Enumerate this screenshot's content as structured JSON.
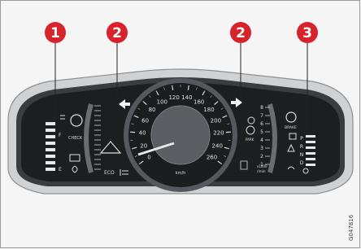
{
  "callouts": [
    {
      "number": "1",
      "color": "#d8232a"
    },
    {
      "number": "2",
      "color": "#d8232a"
    },
    {
      "number": "2",
      "color": "#d8232a"
    },
    {
      "number": "3",
      "color": "#d8232a"
    }
  ],
  "speedometer": {
    "ticks": [
      "0",
      "20",
      "40",
      "60",
      "80",
      "100",
      "120",
      "140",
      "160",
      "180",
      "200",
      "220",
      "240",
      "260"
    ],
    "unit": "km/h"
  },
  "right_gauge": {
    "ticks": [
      "8",
      "7",
      "6",
      "5",
      "4",
      "3",
      "2",
      "1"
    ],
    "unit_line1": "x1000",
    "unit_line2": "r/min"
  },
  "indicators": {
    "eco": "ECO",
    "brake": "BRAKE",
    "park": "PARK",
    "check": "CHECK",
    "gear_letters": [
      "P",
      "R",
      "N",
      "D"
    ],
    "fuel_letters": [
      "F",
      "E"
    ]
  },
  "image_code": "G047816"
}
